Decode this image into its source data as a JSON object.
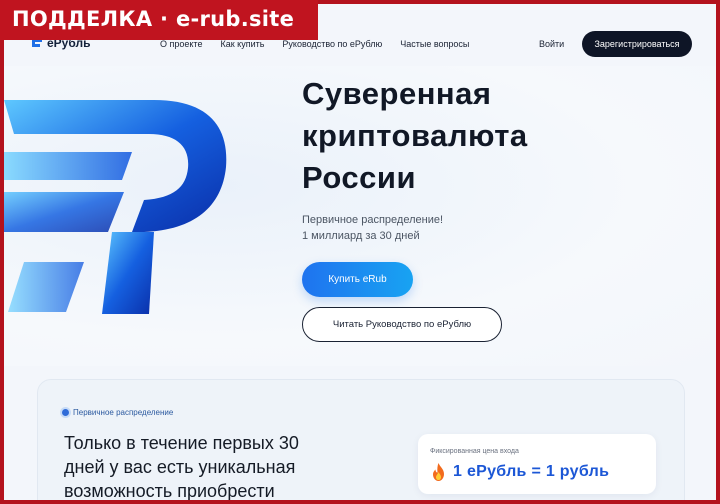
{
  "warning_banner": "ПОДДЕЛКА · e-rub.site",
  "header": {
    "logo_text": "еРубль",
    "nav": [
      {
        "label": "О проекте"
      },
      {
        "label": "Как купить"
      },
      {
        "label": "Руководство по еРублю"
      },
      {
        "label": "Частые вопросы"
      }
    ],
    "login_label": "Войти",
    "register_label": "Зарегистрироваться"
  },
  "hero": {
    "title_lines": [
      "Суверенная",
      "криптовалюта",
      "России"
    ],
    "subtitle_lines": [
      "Первичное распределение!",
      "1 миллиард за 30 дней"
    ],
    "buy_button": "Купить eRub",
    "guide_button": "Читать Руководство по еРублю"
  },
  "card": {
    "badge": "Первичное распределение",
    "text_lines": [
      "Только в течение первых 30",
      "дней у вас есть уникальная",
      "возможность приобрести"
    ],
    "price_label": "Фиксированная цена входа",
    "price_value": "1 еРубль = 1 рубль"
  },
  "icons": {
    "logo": "erub-logo-icon",
    "hero_art": "erub-3d-logo-icon",
    "badge": "status-dot-icon",
    "price": "fire-icon"
  },
  "colors": {
    "banner": "#c0141f",
    "accent_blue": "#1f73ef",
    "dark": "#0e1526",
    "price_text": "#1c57d6"
  }
}
